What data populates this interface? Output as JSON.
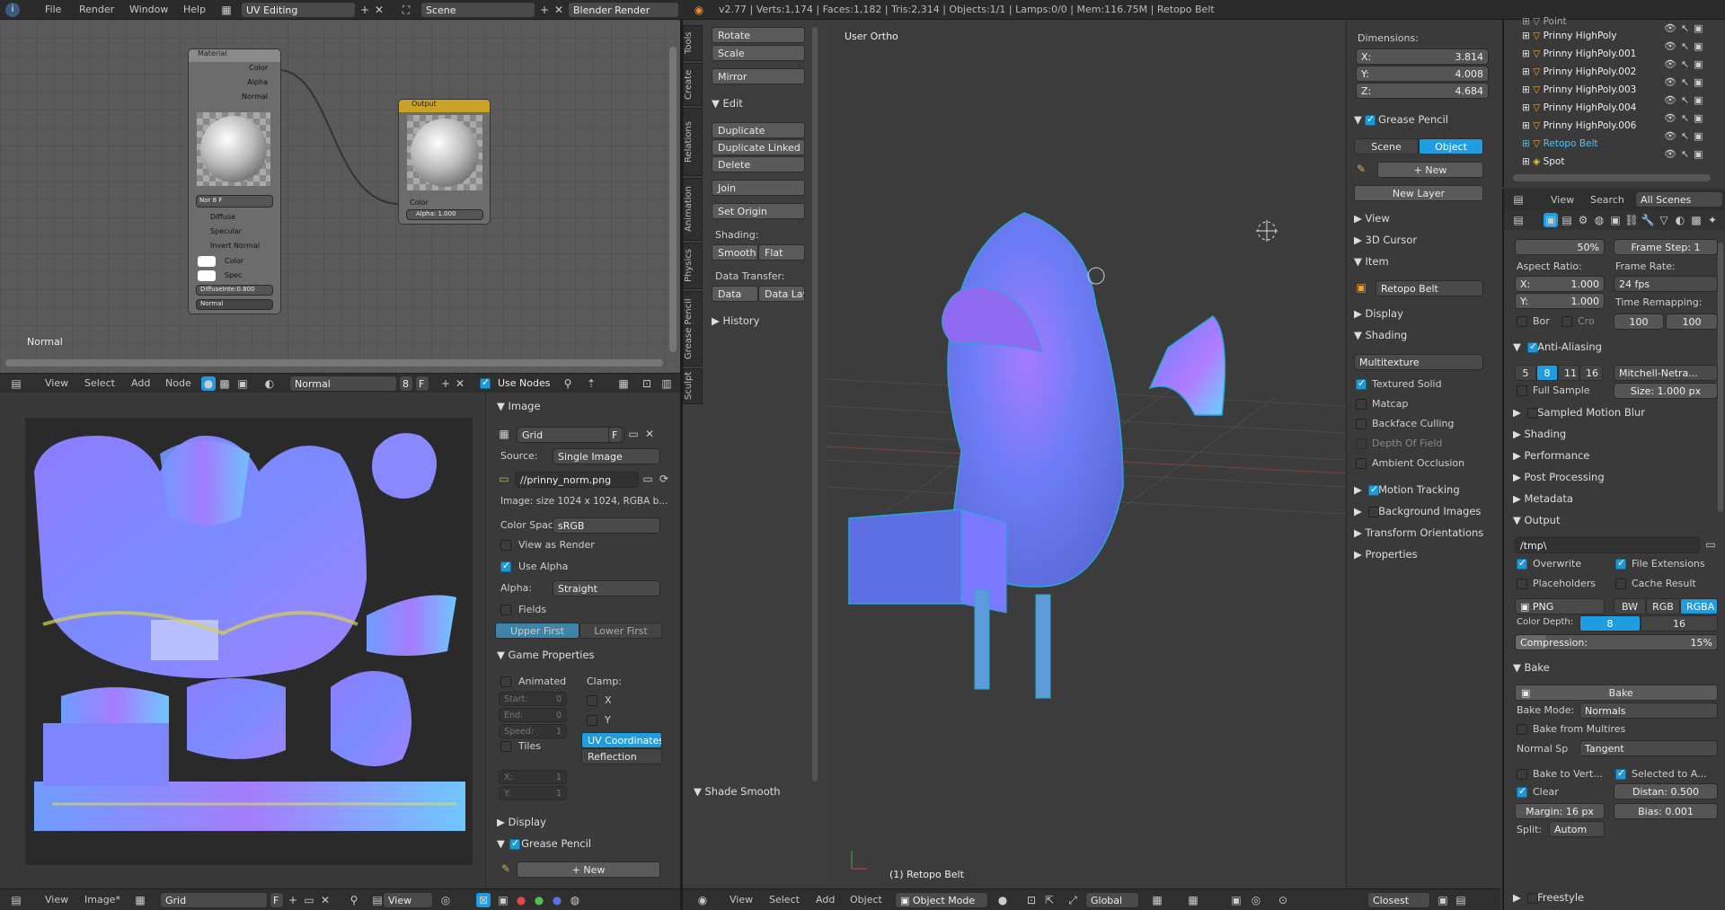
{
  "top": {
    "menus": [
      "File",
      "Render",
      "Window",
      "Help"
    ],
    "layout": "UV Editing",
    "scene": "Scene",
    "engine": "Blender Render",
    "stats": "v2.77 | Verts:1,174 | Faces:1,182 | Tris:2,314 | Objects:1/1 | Lamps:0/0 | Mem:116.75M | Retopo Belt"
  },
  "node_editor": {
    "material_node": {
      "title": "Material",
      "sockets_out": [
        "Color",
        "Alpha",
        "Normal"
      ],
      "mat_field": "Nor",
      "mat_num": "8",
      "mat_f": "F",
      "checks": [
        "Diffuse",
        "Specular",
        "Invert Normal"
      ],
      "inputs": [
        "Color",
        "Spec"
      ],
      "diffuse_intensity": "DiffuseInte:0.800",
      "normal_select": "Normal"
    },
    "output_node": {
      "title": "Output",
      "color": "Color",
      "alpha": "Alpha:",
      "alpha_val": "1.000"
    },
    "corner_label": "Normal",
    "header": {
      "menus": [
        "View",
        "Select",
        "Add",
        "Node"
      ],
      "material": "Normal",
      "users": "8",
      "f": "F",
      "use_nodes": "Use Nodes"
    }
  },
  "uv_editor": {
    "header": {
      "menus": [
        "View",
        "Image*"
      ],
      "image": "Grid",
      "f": "F",
      "view": "View"
    }
  },
  "image_panel": {
    "image_head": "Image",
    "image_name": "Grid",
    "image_f": "F",
    "source_label": "Source:",
    "source": "Single Image",
    "filepath": "//prinny_norm.png",
    "info": "Image: size 1024 x 1024, RGBA b...",
    "colorspace_label": "Color Spac",
    "colorspace": "sRGB",
    "view_as_render": "View as Render",
    "use_alpha": "Use Alpha",
    "alpha_label": "Alpha:",
    "alpha": "Straight",
    "fields": "Fields",
    "upper_first": "Upper First",
    "lower_first": "Lower First",
    "game_props": "Game Properties",
    "animated": "Animated",
    "clamp": "Clamp:",
    "start": "Start:",
    "start_v": "0",
    "end": "End:",
    "end_v": "0",
    "speed": "Speed:",
    "speed_v": "1",
    "x": "X",
    "y": "Y",
    "tiles": "Tiles",
    "uv_coords": "UV Coordinates",
    "reflection": "Reflection",
    "tx": "X:",
    "tx_v": "1",
    "ty": "Y:",
    "ty_v": "1",
    "display": "Display",
    "grease": "Grease Pencil",
    "new": "New"
  },
  "tools": {
    "tabs": [
      "Tools",
      "Create",
      "Relations",
      "Animation",
      "Physics",
      "Grease Pencil",
      "Sculpt"
    ],
    "transform_btns": [
      "Rotate",
      "Scale",
      "Mirror"
    ],
    "edit": "Edit",
    "edit_btns": [
      "Duplicate",
      "Duplicate Linked",
      "Delete",
      "Join",
      "Set Origin"
    ],
    "shading": "Shading:",
    "smooth": "Smooth",
    "flat": "Flat",
    "data_transfer": "Data Transfer:",
    "data": "Data",
    "data_lay": "Data Lay",
    "history": "History",
    "shade_smooth": "Shade Smooth"
  },
  "viewport": {
    "view_label": "User Ortho",
    "object_label": "(1) Retopo Belt",
    "header": {
      "menus": [
        "View",
        "Select",
        "Add",
        "Object"
      ],
      "mode": "Object Mode",
      "orientation": "Global",
      "snap": "Closest"
    }
  },
  "npanel": {
    "dimensions": "Dimensions:",
    "dx": "X:",
    "dx_v": "3.814",
    "dy": "Y:",
    "dy_v": "4.008",
    "dz": "Z:",
    "dz_v": "4.684",
    "grease": "Grease Pencil",
    "scene": "Scene",
    "object": "Object",
    "new": "New",
    "new_layer": "New Layer",
    "sections": [
      "View",
      "3D Cursor",
      "Item"
    ],
    "item_name": "Retopo Belt",
    "display": "Display",
    "shading": "Shading",
    "shading_mode": "Multitexture",
    "shade_checks": [
      "Textured Solid",
      "Matcap",
      "Backface Culling",
      "Depth Of Field",
      "Ambient Occlusion"
    ],
    "motion": "Motion Tracking",
    "bg": "Background Images",
    "transform_orient": "Transform Orientations",
    "properties": "Properties"
  },
  "outliner": {
    "items": [
      "Point",
      "Prinny HighPoly",
      "Prinny HighPoly.001",
      "Prinny HighPoly.002",
      "Prinny HighPoly.003",
      "Prinny HighPoly.004",
      "Prinny HighPoly.006",
      "Retopo Belt",
      "Spot"
    ]
  },
  "properties": {
    "tabs": [
      "View",
      "Search",
      "All Scenes"
    ],
    "percent": "50%",
    "frame_step": "Frame Step: 1",
    "aspect": "Aspect Ratio:",
    "frame_rate": "Frame Rate:",
    "ax": "X:",
    "ax_v": "1.000",
    "ay": "Y:",
    "ay_v": "1.000",
    "fps": "24 fps",
    "time_remap": "Time Remapping:",
    "bor": "Bor",
    "cro": "Cro",
    "tr1": "100",
    "tr2": "100",
    "aa": "Anti-Aliasing",
    "aa_samples": [
      "5",
      "8",
      "11",
      "16"
    ],
    "filter": "Mitchell-Netra...",
    "full_sample": "Full Sample",
    "size": "Size: 1.000 px",
    "sections": [
      "Sampled Motion Blur",
      "Shading",
      "Performance",
      "Post Processing",
      "Metadata"
    ],
    "output": "Output",
    "path": "/tmp\\",
    "overwrite": "Overwrite",
    "file_ext": "File Extensions",
    "placeholders": "Placeholders",
    "cache": "Cache Result",
    "format": "PNG",
    "bw": "BW",
    "rgb": "RGB",
    "rgba": "RGBA",
    "color_depth": "Color Depth:",
    "cd8": "8",
    "cd16": "16",
    "compression": "Compression:",
    "compression_v": "15%",
    "bake": "Bake",
    "bake_btn": "Bake",
    "bake_mode_label": "Bake Mode:",
    "bake_mode": "Normals",
    "bake_multires": "Bake from Multires",
    "normal_sp": "Normal Sp",
    "tangent": "Tangent",
    "bake_vert": "Bake to Vert...",
    "selected_to": "Selected to A...",
    "clear": "Clear",
    "distance": "Distan: 0.500",
    "margin": "Margin: 16 px",
    "bias": "Bias: 0.001",
    "split": "Split:",
    "split_v": "Autom",
    "freestyle": "Freestyle"
  }
}
